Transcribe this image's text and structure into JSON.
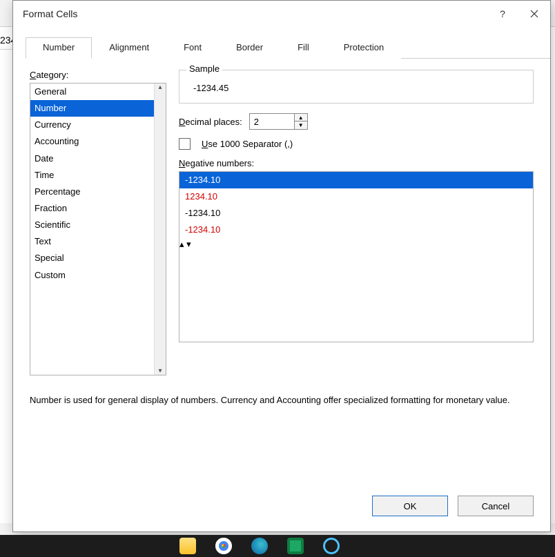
{
  "background": {
    "cell_text": "234"
  },
  "dialog": {
    "title": "Format Cells",
    "help_icon": "?",
    "tabs": [
      "Number",
      "Alignment",
      "Font",
      "Border",
      "Fill",
      "Protection"
    ],
    "active_tab": 0,
    "category_label": "Category:",
    "categories": [
      "General",
      "Number",
      "Currency",
      "Accounting",
      "Date",
      "Time",
      "Percentage",
      "Fraction",
      "Scientific",
      "Text",
      "Special",
      "Custom"
    ],
    "selected_category": 1,
    "sample_label": "Sample",
    "sample_value": "-1234.45",
    "decimal_label": "Decimal places:",
    "decimal_value": "2",
    "separator_label": "Use 1000 Separator (,)",
    "negative_label": "Negative numbers:",
    "negative_items": [
      {
        "text": "-1234.10",
        "red": false
      },
      {
        "text": "1234.10",
        "red": true
      },
      {
        "text": "-1234.10",
        "red": false
      },
      {
        "text": "-1234.10",
        "red": true
      }
    ],
    "negative_selected": 0,
    "description": "Number is used for general display of numbers.  Currency and Accounting offer specialized formatting for monetary value.",
    "ok": "OK",
    "cancel": "Cancel"
  }
}
